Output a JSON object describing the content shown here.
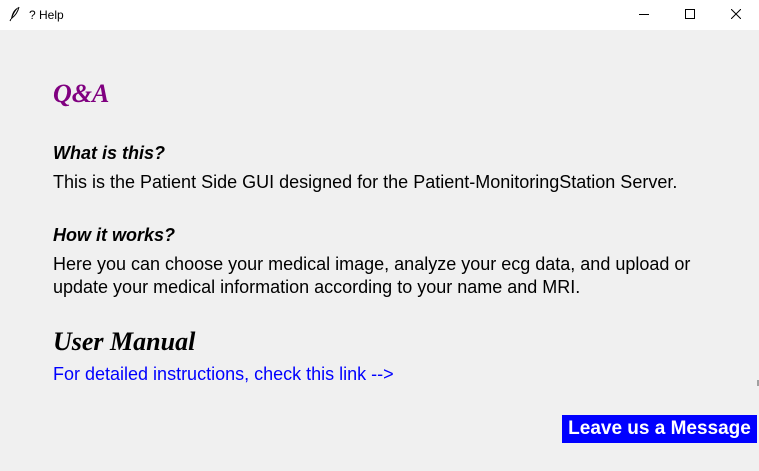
{
  "window": {
    "title": "? Help",
    "icons": {
      "app": "feather-icon",
      "minimize": "minimize-icon",
      "maximize": "maximize-icon",
      "close": "close-icon"
    }
  },
  "content": {
    "qa_heading": "Q&A",
    "sections": [
      {
        "question": "What is this?",
        "answer_lines": [
          "This is the Patient Side GUI designed for the Patient-MonitoringStation Server."
        ]
      },
      {
        "question": "How it works?",
        "answer_lines": [
          "Here you can choose your medical image, analyze your ecg data, and upload or",
          "update your medical information according to your name and MRI."
        ]
      }
    ],
    "manual_heading": "User Manual",
    "manual_link": "For detailed instructions, check this link -->",
    "message_button": "Leave us a Message"
  },
  "colors": {
    "background": "#f0f0f0",
    "titlebar": "#ffffff",
    "qa_heading": "#800080",
    "link": "#0000ff",
    "button_bg": "#0000ff",
    "button_text": "#ffffff"
  }
}
